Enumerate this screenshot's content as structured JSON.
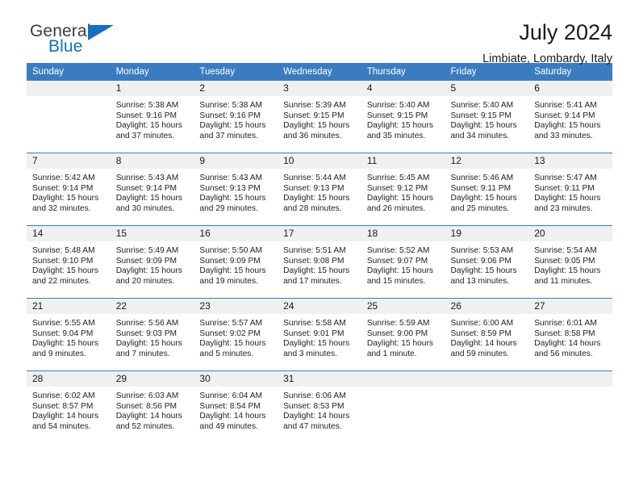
{
  "brand": {
    "name_part1": "General",
    "name_part2": "Blue",
    "logo_icon": "triangle-flag-icon",
    "accent_color": "#1670c0"
  },
  "header": {
    "title": "July 2024",
    "subtitle": "Limbiate, Lombardy, Italy"
  },
  "calendar": {
    "header_color": "#3b7cc0",
    "daynum_bg": "#f0f0f0",
    "weekdays": [
      "Sunday",
      "Monday",
      "Tuesday",
      "Wednesday",
      "Thursday",
      "Friday",
      "Saturday"
    ],
    "weeks": [
      [
        {
          "day": "",
          "lines": []
        },
        {
          "day": "1",
          "lines": [
            "Sunrise: 5:38 AM",
            "Sunset: 9:16 PM",
            "Daylight: 15 hours",
            "and 37 minutes."
          ]
        },
        {
          "day": "2",
          "lines": [
            "Sunrise: 5:38 AM",
            "Sunset: 9:16 PM",
            "Daylight: 15 hours",
            "and 37 minutes."
          ]
        },
        {
          "day": "3",
          "lines": [
            "Sunrise: 5:39 AM",
            "Sunset: 9:15 PM",
            "Daylight: 15 hours",
            "and 36 minutes."
          ]
        },
        {
          "day": "4",
          "lines": [
            "Sunrise: 5:40 AM",
            "Sunset: 9:15 PM",
            "Daylight: 15 hours",
            "and 35 minutes."
          ]
        },
        {
          "day": "5",
          "lines": [
            "Sunrise: 5:40 AM",
            "Sunset: 9:15 PM",
            "Daylight: 15 hours",
            "and 34 minutes."
          ]
        },
        {
          "day": "6",
          "lines": [
            "Sunrise: 5:41 AM",
            "Sunset: 9:14 PM",
            "Daylight: 15 hours",
            "and 33 minutes."
          ]
        }
      ],
      [
        {
          "day": "7",
          "lines": [
            "Sunrise: 5:42 AM",
            "Sunset: 9:14 PM",
            "Daylight: 15 hours",
            "and 32 minutes."
          ]
        },
        {
          "day": "8",
          "lines": [
            "Sunrise: 5:43 AM",
            "Sunset: 9:14 PM",
            "Daylight: 15 hours",
            "and 30 minutes."
          ]
        },
        {
          "day": "9",
          "lines": [
            "Sunrise: 5:43 AM",
            "Sunset: 9:13 PM",
            "Daylight: 15 hours",
            "and 29 minutes."
          ]
        },
        {
          "day": "10",
          "lines": [
            "Sunrise: 5:44 AM",
            "Sunset: 9:13 PM",
            "Daylight: 15 hours",
            "and 28 minutes."
          ]
        },
        {
          "day": "11",
          "lines": [
            "Sunrise: 5:45 AM",
            "Sunset: 9:12 PM",
            "Daylight: 15 hours",
            "and 26 minutes."
          ]
        },
        {
          "day": "12",
          "lines": [
            "Sunrise: 5:46 AM",
            "Sunset: 9:11 PM",
            "Daylight: 15 hours",
            "and 25 minutes."
          ]
        },
        {
          "day": "13",
          "lines": [
            "Sunrise: 5:47 AM",
            "Sunset: 9:11 PM",
            "Daylight: 15 hours",
            "and 23 minutes."
          ]
        }
      ],
      [
        {
          "day": "14",
          "lines": [
            "Sunrise: 5:48 AM",
            "Sunset: 9:10 PM",
            "Daylight: 15 hours",
            "and 22 minutes."
          ]
        },
        {
          "day": "15",
          "lines": [
            "Sunrise: 5:49 AM",
            "Sunset: 9:09 PM",
            "Daylight: 15 hours",
            "and 20 minutes."
          ]
        },
        {
          "day": "16",
          "lines": [
            "Sunrise: 5:50 AM",
            "Sunset: 9:09 PM",
            "Daylight: 15 hours",
            "and 19 minutes."
          ]
        },
        {
          "day": "17",
          "lines": [
            "Sunrise: 5:51 AM",
            "Sunset: 9:08 PM",
            "Daylight: 15 hours",
            "and 17 minutes."
          ]
        },
        {
          "day": "18",
          "lines": [
            "Sunrise: 5:52 AM",
            "Sunset: 9:07 PM",
            "Daylight: 15 hours",
            "and 15 minutes."
          ]
        },
        {
          "day": "19",
          "lines": [
            "Sunrise: 5:53 AM",
            "Sunset: 9:06 PM",
            "Daylight: 15 hours",
            "and 13 minutes."
          ]
        },
        {
          "day": "20",
          "lines": [
            "Sunrise: 5:54 AM",
            "Sunset: 9:05 PM",
            "Daylight: 15 hours",
            "and 11 minutes."
          ]
        }
      ],
      [
        {
          "day": "21",
          "lines": [
            "Sunrise: 5:55 AM",
            "Sunset: 9:04 PM",
            "Daylight: 15 hours",
            "and 9 minutes."
          ]
        },
        {
          "day": "22",
          "lines": [
            "Sunrise: 5:56 AM",
            "Sunset: 9:03 PM",
            "Daylight: 15 hours",
            "and 7 minutes."
          ]
        },
        {
          "day": "23",
          "lines": [
            "Sunrise: 5:57 AM",
            "Sunset: 9:02 PM",
            "Daylight: 15 hours",
            "and 5 minutes."
          ]
        },
        {
          "day": "24",
          "lines": [
            "Sunrise: 5:58 AM",
            "Sunset: 9:01 PM",
            "Daylight: 15 hours",
            "and 3 minutes."
          ]
        },
        {
          "day": "25",
          "lines": [
            "Sunrise: 5:59 AM",
            "Sunset: 9:00 PM",
            "Daylight: 15 hours",
            "and 1 minute."
          ]
        },
        {
          "day": "26",
          "lines": [
            "Sunrise: 6:00 AM",
            "Sunset: 8:59 PM",
            "Daylight: 14 hours",
            "and 59 minutes."
          ]
        },
        {
          "day": "27",
          "lines": [
            "Sunrise: 6:01 AM",
            "Sunset: 8:58 PM",
            "Daylight: 14 hours",
            "and 56 minutes."
          ]
        }
      ],
      [
        {
          "day": "28",
          "lines": [
            "Sunrise: 6:02 AM",
            "Sunset: 8:57 PM",
            "Daylight: 14 hours",
            "and 54 minutes."
          ]
        },
        {
          "day": "29",
          "lines": [
            "Sunrise: 6:03 AM",
            "Sunset: 8:56 PM",
            "Daylight: 14 hours",
            "and 52 minutes."
          ]
        },
        {
          "day": "30",
          "lines": [
            "Sunrise: 6:04 AM",
            "Sunset: 8:54 PM",
            "Daylight: 14 hours",
            "and 49 minutes."
          ]
        },
        {
          "day": "31",
          "lines": [
            "Sunrise: 6:06 AM",
            "Sunset: 8:53 PM",
            "Daylight: 14 hours",
            "and 47 minutes."
          ]
        },
        {
          "day": "",
          "lines": []
        },
        {
          "day": "",
          "lines": []
        },
        {
          "day": "",
          "lines": []
        }
      ]
    ]
  }
}
